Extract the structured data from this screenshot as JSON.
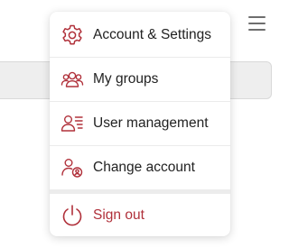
{
  "menu": {
    "items": [
      {
        "label": "Account & Settings",
        "icon": "gear-icon"
      },
      {
        "label": "My groups",
        "icon": "group-icon"
      },
      {
        "label": "User management",
        "icon": "user-list-icon"
      },
      {
        "label": "Change account",
        "icon": "switch-user-icon"
      }
    ],
    "signout": {
      "label": "Sign out",
      "icon": "power-icon"
    }
  },
  "header": {
    "menu_icon": "hamburger-menu-icon"
  },
  "colors": {
    "icon_accent": "#b0303a",
    "signout_text": "#b0303a",
    "text": "#222222"
  }
}
